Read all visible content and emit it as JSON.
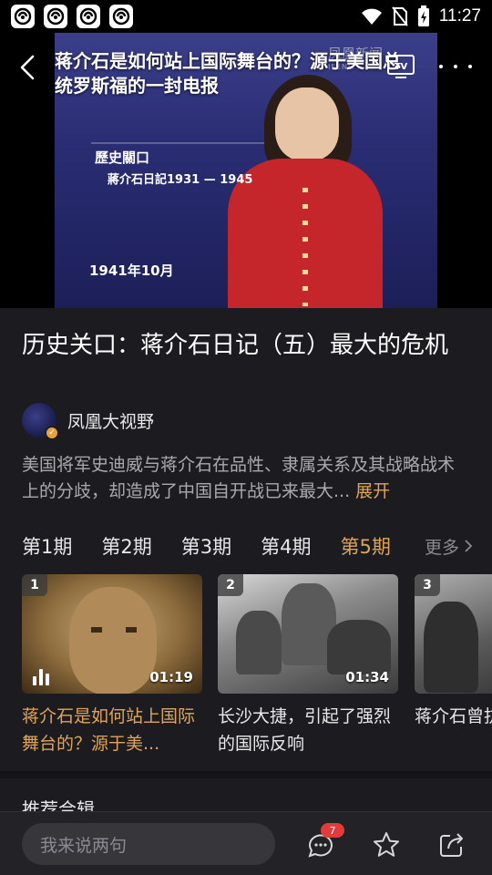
{
  "status_bar": {
    "time": "11:27",
    "app_icons": [
      "ifeng-icon",
      "ifeng-icon",
      "ifeng-icon",
      "ifeng-icon"
    ]
  },
  "video": {
    "overlay_title": "蒋介石是如何站上国际舞台的？源于美国总统罗斯福的一封电报",
    "caption_line1": "歷史關口",
    "caption_line2": "蔣介石日記1931 — 1945",
    "caption_line3": "1941年10月",
    "watermark_main": "凤凰新闻",
    "watermark_sub": "IFENG"
  },
  "episode": {
    "title": "历史关口：蒋介石日记（五）最大的危机",
    "channel_name": "凤凰大视野",
    "description": "美国将军史迪威与蒋介石在品性、隶属关系及其战略战术上的分歧，却造成了中国自开战已来最大...",
    "expand_label": "展开"
  },
  "tabs": {
    "items": [
      "第1期",
      "第2期",
      "第3期",
      "第4期",
      "第5期"
    ],
    "active_index": 4,
    "more_label": "更多"
  },
  "episodes": [
    {
      "number": "1",
      "duration": "01:19",
      "name": "蒋介石是如何站上国际舞台的？源于美...",
      "active": true
    },
    {
      "number": "2",
      "duration": "01:34",
      "name": "长沙大捷，引起了强烈的国际反响",
      "active": false
    },
    {
      "number": "3",
      "duration": "",
      "name": "蒋介石曾抗日，却",
      "active": false
    }
  ],
  "section_peek": "推荐合辑",
  "bottom_bar": {
    "comment_placeholder": "我来说两句",
    "comment_count": "7"
  },
  "colors": {
    "accent": "#e0a458",
    "background": "#1c1c20",
    "badge": "#e23b3b"
  }
}
